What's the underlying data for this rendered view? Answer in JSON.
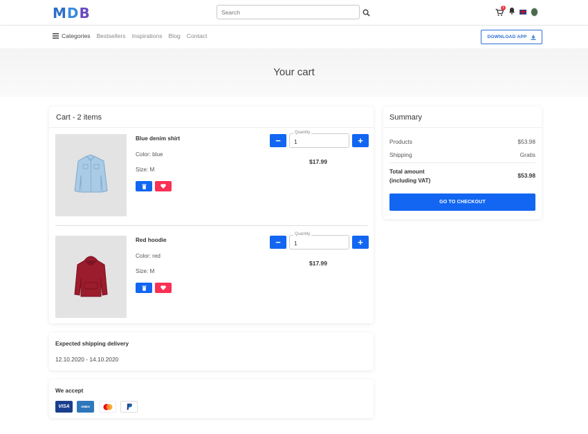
{
  "header": {
    "logo": {
      "l1": "M",
      "l2": "D",
      "l3": "B"
    },
    "search_placeholder": "Search",
    "cart_count": "1",
    "download_label": "DOWNLOAD APP"
  },
  "nav": {
    "categories": "Categories",
    "items": [
      "Bestsellers",
      "Inspirations",
      "Blog",
      "Contact"
    ]
  },
  "page_title": "Your cart",
  "cart": {
    "header": "Cart - 2 items",
    "quantity_label": "Quantity",
    "items": [
      {
        "name": "Blue denim shirt",
        "color": "Color: blue",
        "size": "Size: M",
        "quantity": "1",
        "price": "$17.99",
        "image": "denim-shirt"
      },
      {
        "name": "Red hoodie",
        "color": "Color: red",
        "size": "Size: M",
        "quantity": "1",
        "price": "$17.99",
        "image": "red-hoodie"
      }
    ]
  },
  "shipping": {
    "title": "Expected shipping delivery",
    "dates": "12.10.2020 - 14.10.2020"
  },
  "accept": {
    "title": "We accept",
    "cards": [
      "VISA",
      "AMEX",
      "Mastercard",
      "PayPal"
    ]
  },
  "summary": {
    "title": "Summary",
    "products_label": "Products",
    "products_value": "$53.98",
    "shipping_label": "Shipping",
    "shipping_value": "Gratis",
    "total_label_1": "Total amount",
    "total_label_2": "(including VAT)",
    "total_value": "$53.98",
    "checkout_label": "GO TO CHECKOUT"
  },
  "colors": {
    "primary": "#1266f1",
    "danger": "#f93154",
    "accent_outline": "#2b6dd3"
  }
}
